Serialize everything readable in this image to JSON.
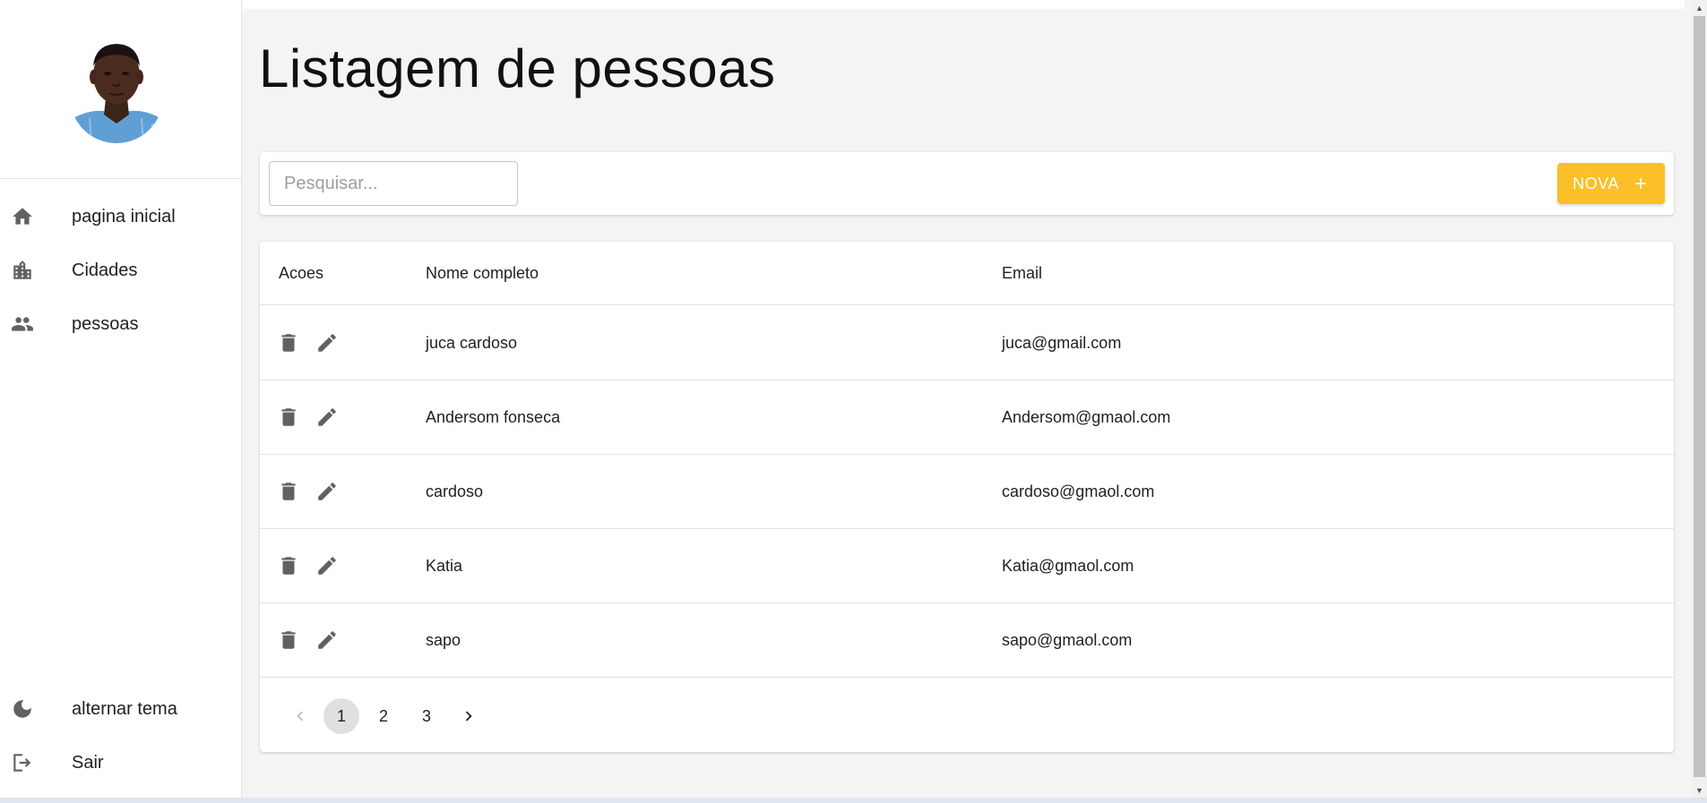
{
  "sidebar": {
    "nav_items": [
      {
        "label": "pagina inicial",
        "icon": "home-icon"
      },
      {
        "label": "Cidades",
        "icon": "city-icon"
      },
      {
        "label": "pessoas",
        "icon": "people-icon"
      }
    ],
    "bottom_items": [
      {
        "label": "alternar tema",
        "icon": "moon-icon"
      },
      {
        "label": "Sair",
        "icon": "logout-icon"
      }
    ]
  },
  "main": {
    "title": "Listagem de pessoas",
    "search": {
      "placeholder": "Pesquisar...",
      "value": ""
    },
    "new_button": {
      "label": "NOVA"
    },
    "table": {
      "headers": [
        "Acoes",
        "Nome completo",
        "Email"
      ],
      "rows": [
        {
          "name": "juca cardoso",
          "email": "juca@gmail.com"
        },
        {
          "name": "Andersom fonseca",
          "email": "Andersom@gmaol.com"
        },
        {
          "name": "cardoso",
          "email": "cardoso@gmaol.com"
        },
        {
          "name": "Katia",
          "email": "Katia@gmaol.com"
        },
        {
          "name": "sapo",
          "email": "sapo@gmaol.com"
        }
      ]
    },
    "pagination": {
      "pages": [
        "1",
        "2",
        "3"
      ],
      "current": "1"
    }
  },
  "colors": {
    "accent": "#fbbf2a",
    "background": "#f5f4f2",
    "icon": "#616161"
  }
}
